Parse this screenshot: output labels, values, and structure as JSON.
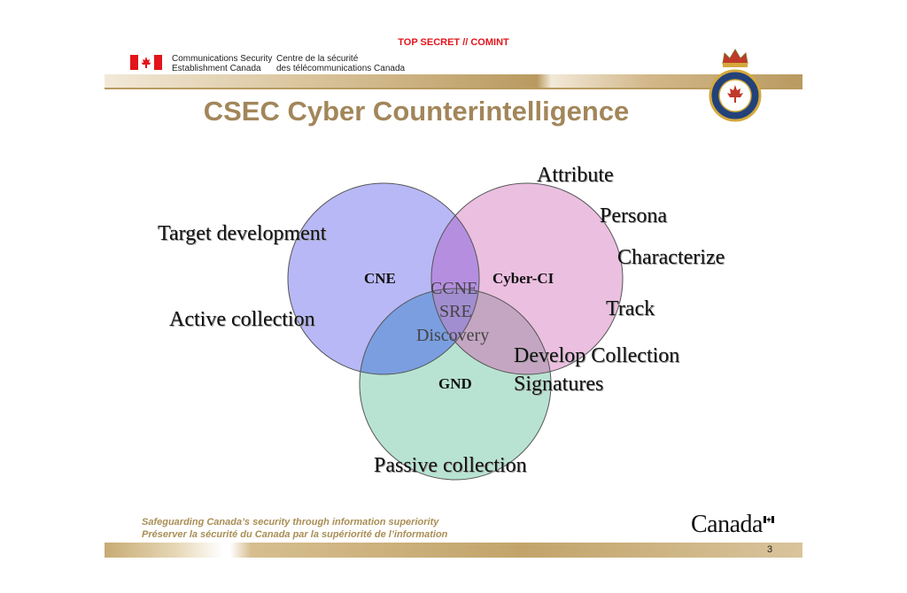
{
  "header": {
    "classification": "TOP SECRET // COMINT",
    "agency_en_line1": "Communications Security",
    "agency_en_line2": "Establishment Canada",
    "agency_fr_line1": "Centre de la sécurité",
    "agency_fr_line2": "des télécommunications Canada"
  },
  "title": "CSEC Cyber Counterintelligence",
  "diagram": {
    "circles": [
      {
        "name": "CNE",
        "fill": "#b8b8f7"
      },
      {
        "name": "Cyber-CI",
        "fill": "#ebbfe0"
      },
      {
        "name": "GND",
        "fill": "#b8e3d2"
      }
    ],
    "intersections": {
      "cne_cyberci": "#b58ee0",
      "cne_gnd": "#7a9ee0",
      "cyberci_gnd": "#c4a6c2"
    },
    "center_labels": [
      "CCNE",
      "SRE",
      "Discovery"
    ],
    "left_labels": [
      "Target development",
      "Active collection"
    ],
    "right_labels": [
      "Attribute",
      "Persona",
      "Characterize",
      "Track",
      "Develop Collection",
      "Signatures"
    ],
    "bottom_label": "Passive collection"
  },
  "footer": {
    "motto_en": "Safeguarding Canada’s security through information superiority",
    "motto_fr": "Préserver la sécurité du Canada par la supériorité de l’information",
    "wordmark": "Canada",
    "page_number": "3"
  },
  "colors": {
    "classification": "#e3141b",
    "title": "#a2865a",
    "gold": "#b99a60"
  }
}
